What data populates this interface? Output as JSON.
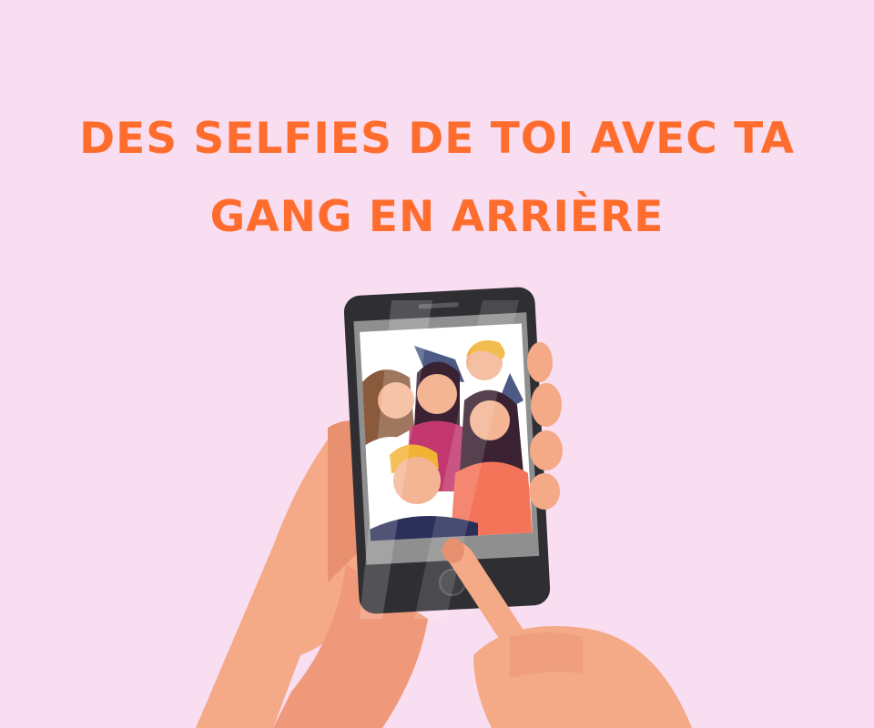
{
  "headline": {
    "line1": "DES SELFIES DE TOI AVEC TA",
    "line2": "GANG EN ARRIÈRE"
  },
  "colors": {
    "background": "#f9ddf0",
    "headline": "#ff6d2e",
    "skin": "#f4a987",
    "skin_shadow": "#e8906f",
    "phone_body": "#2e2e33",
    "phone_screen_frame": "#9b9b9b"
  },
  "illustration": {
    "subject": "hand-holding-phone-with-group-selfie",
    "people_count": 5
  }
}
